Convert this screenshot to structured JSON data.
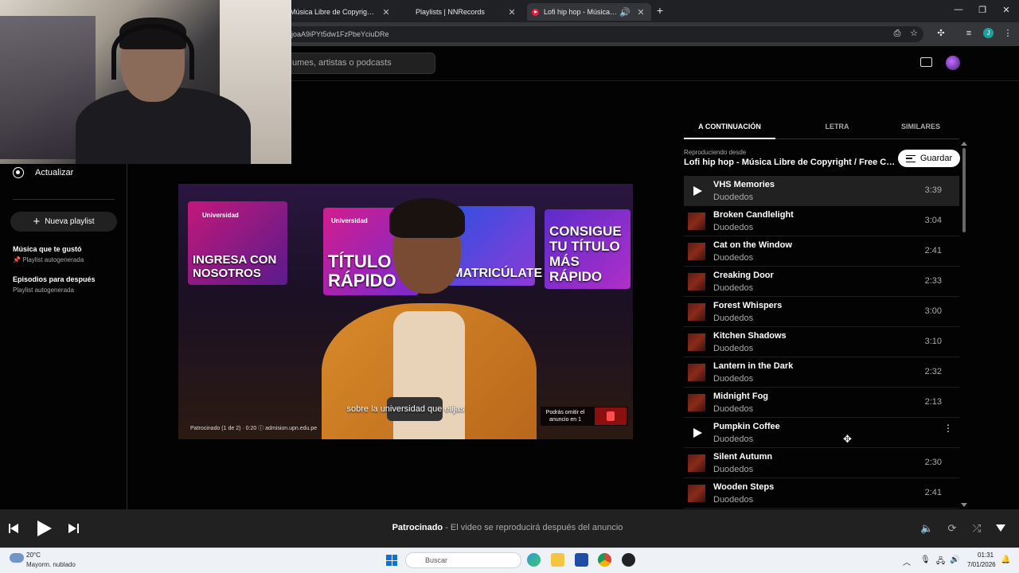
{
  "browser": {
    "tabs": [
      {
        "title": "Música Libre de Copyright Grat",
        "active": false
      },
      {
        "title": "Playlists | NNRecords",
        "active": false
      },
      {
        "title": "Lofi hip hop - Música Libre",
        "active": true
      }
    ],
    "url_partial": "joaA9iPYt5dw1FzPbeYciuDRe",
    "profile_initial": "J"
  },
  "header": {
    "search_placeholder_partial": "umes, artistas o podcasts"
  },
  "sidebar": {
    "update_label": "Actualizar",
    "new_playlist_label": "Nueva playlist",
    "playlists": [
      {
        "title": "Música que te gustó",
        "subtitle": "Playlist autogenerada",
        "pinned": true
      },
      {
        "title": "Episodios para después",
        "subtitle": "Playlist autogenerada",
        "pinned": false
      }
    ]
  },
  "video": {
    "panels": [
      "INGRESA CON NOSOTROS",
      "TÍTULO RÁPIDO",
      "MATRICÚLATE",
      "CONSIGUE TU TÍTULO MÁS RÁPIDO"
    ],
    "brand": "Universidad",
    "subtitle": "sobre la universidad que elijas",
    "sponsor_text": "Patrocinado (1 de 2) · 0:20 ⓘ admision.upn.edu.pe",
    "skip_text": "Podrás omitir el anuncio en 1"
  },
  "queue_panel": {
    "tabs": [
      "A CONTINUACIÓN",
      "LETRA",
      "SIMILARES"
    ],
    "playing_from_label": "Reproduciendo desde",
    "playlist_name": "Lofi hip hop - Música Libre de Copyright / Free Copyright",
    "save_label": "Guardar",
    "tracks": [
      {
        "title": "VHS Memories",
        "artist": "Duodedos",
        "duration": "3:39",
        "state": "current"
      },
      {
        "title": "Broken Candlelight",
        "artist": "Duodedos",
        "duration": "3:04",
        "state": "normal"
      },
      {
        "title": "Cat on the Window",
        "artist": "Duodedos",
        "duration": "2:41",
        "state": "normal"
      },
      {
        "title": "Creaking Door",
        "artist": "Duodedos",
        "duration": "2:33",
        "state": "normal"
      },
      {
        "title": "Forest Whispers",
        "artist": "Duodedos",
        "duration": "3:00",
        "state": "normal"
      },
      {
        "title": "Kitchen Shadows",
        "artist": "Duodedos",
        "duration": "3:10",
        "state": "normal"
      },
      {
        "title": "Lantern in the Dark",
        "artist": "Duodedos",
        "duration": "2:32",
        "state": "normal"
      },
      {
        "title": "Midnight Fog",
        "artist": "Duodedos",
        "duration": "2:13",
        "state": "normal"
      },
      {
        "title": "Pumpkin Coffee",
        "artist": "Duodedos",
        "duration": "",
        "state": "hover"
      },
      {
        "title": "Silent Autumn",
        "artist": "Duodedos",
        "duration": "2:30",
        "state": "normal"
      },
      {
        "title": "Wooden Steps",
        "artist": "Duodedos",
        "duration": "2:41",
        "state": "normal"
      }
    ]
  },
  "player": {
    "status_bold": "Patrocinado",
    "status_text": " - El video se reproducirá después del anuncio"
  },
  "taskbar": {
    "temperature": "20°C",
    "condition": "Mayorm. nublado",
    "search_placeholder": "Buscar",
    "time": "01:31",
    "date": "7/01/2026"
  },
  "colors": {
    "background": "#030303",
    "player_bar": "#212121",
    "accent_youtube": "#e11d48"
  }
}
